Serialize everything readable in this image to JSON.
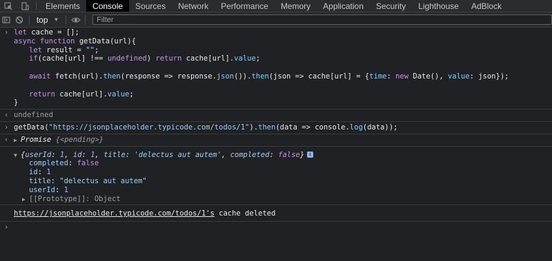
{
  "tabs": [
    "Elements",
    "Console",
    "Sources",
    "Network",
    "Performance",
    "Memory",
    "Application",
    "Security",
    "Lighthouse",
    "AdBlock"
  ],
  "active_tab": "Console",
  "toolbar": {
    "context": "top",
    "filter_placeholder": "Filter"
  },
  "console": {
    "input1": [
      "let cache = [];",
      "async function getData(url){",
      "    let result = \"\";",
      "    if(cache[url] !== undefined) return cache[url].value;",
      "",
      "    await fetch(url).then(response => response.json()).then(json => cache[url] = {time: new Date(), value: json});",
      "",
      "    return cache[url].value;",
      "}"
    ],
    "output1": "undefined",
    "input2": "getData(\"https://jsonplaceholder.typicode.com/todos/1\").then(data => console.log(data));",
    "output2": "Promise {<pending>}",
    "log_object_summary": "{userId: 1, id: 1, title: 'delectus aut autem', completed: false}",
    "log_object_props": [
      {
        "key": "completed",
        "value": "false"
      },
      {
        "key": "id",
        "value": "1"
      },
      {
        "key": "title",
        "value": "\"delectus aut autem\""
      },
      {
        "key": "userId",
        "value": "1"
      }
    ],
    "log_prototype": "[[Prototype]]: Object",
    "log2_link": "https://jsonplaceholder.typicode.com/todos/1's",
    "log2_text": " cache deleted"
  }
}
